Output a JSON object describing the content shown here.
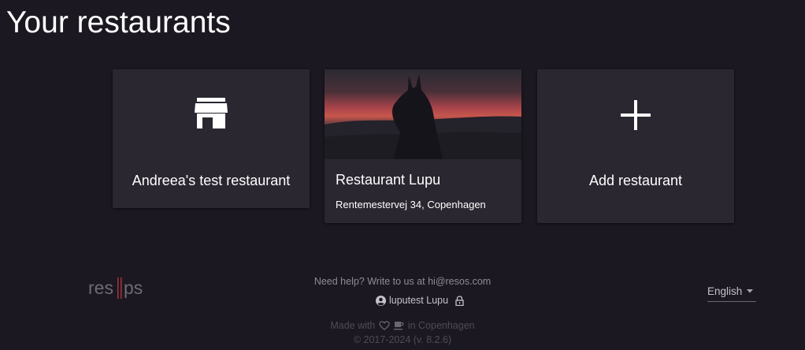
{
  "page": {
    "title": "Your restaurants"
  },
  "restaurants": [
    {
      "name": "Andreea's test restaurant",
      "icon": "store-icon"
    },
    {
      "name": "Restaurant Lupu",
      "address": "Rentemestervej 34, Copenhagen",
      "image": "wolf-silhouette-sunset-photo"
    }
  ],
  "add_card": {
    "label": "Add restaurant",
    "icon": "plus-icon"
  },
  "footer": {
    "logo": "resos-logo",
    "help_text": "Need help? Write to us at hi@resos.com",
    "user": {
      "name": "luputest Lupu",
      "icon": "account-circle-icon",
      "lock_icon": "lock-icon"
    },
    "made_with_prefix": "Made with",
    "made_with_suffix": "in Copenhagen",
    "copyright": "© 2017-2024 (v. 8.2.6)"
  },
  "language": {
    "selected": "English"
  },
  "colors": {
    "background": "#1b1821",
    "card": "#2a2730",
    "text": "#ffffff",
    "muted": "#8e8b93",
    "dim": "#4f4c56",
    "logo_accent": "#a8343a"
  }
}
